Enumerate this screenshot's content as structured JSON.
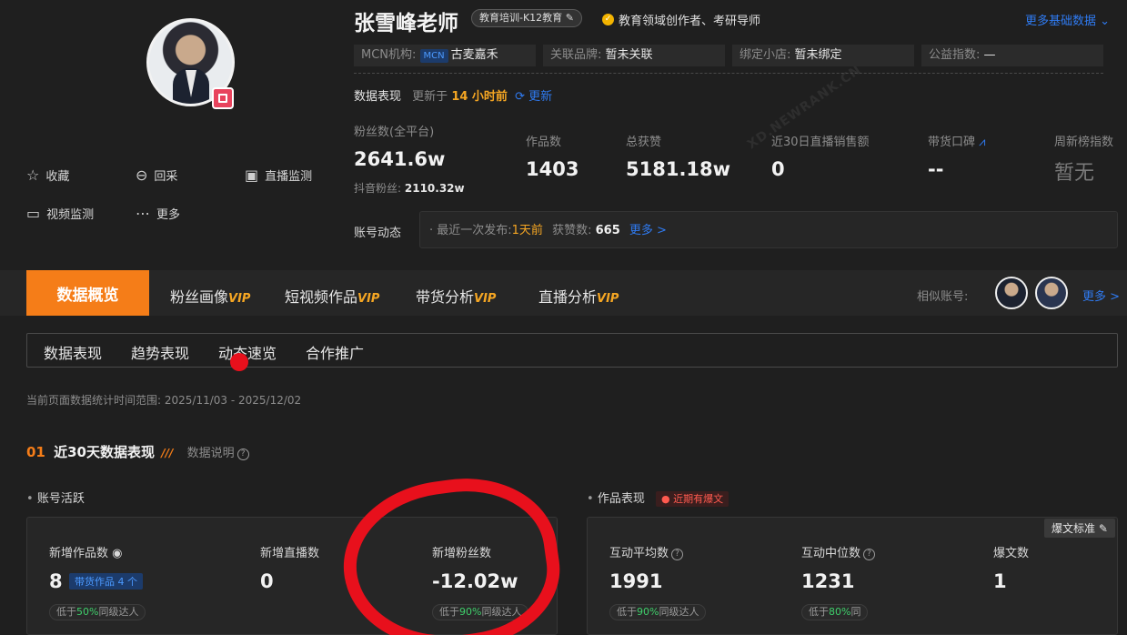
{
  "profile": {
    "name": "张雪峰老师",
    "tag": "教育培训-K12教育",
    "verify_text": "教育领域创作者、考研导师",
    "more_base": "更多基础数据",
    "mcn_label": "MCN机构:",
    "mcn_badge": "MCN",
    "mcn_value": "古麦嘉禾",
    "brand_label": "关联品牌:",
    "brand_value": "暂未关联",
    "shop_label": "绑定小店:",
    "shop_value": "暂未绑定",
    "charity_label": "公益指数:",
    "charity_value": "—"
  },
  "actions": {
    "collect": "收藏",
    "backtrack": "回采",
    "live_monitor": "直播监测",
    "video_monitor": "视频监测",
    "more": "更多"
  },
  "perf": {
    "title": "数据表现",
    "updated_prefix": "更新于",
    "updated_value": "14 小时前",
    "refresh": "更新",
    "fans_label": "粉丝数(全平台)",
    "fans_value": "2641.6w",
    "douyin_label": "抖音粉丝:",
    "douyin_value": "2110.32w",
    "works_label": "作品数",
    "works_value": "1403",
    "likes_label": "总获赞",
    "likes_value": "5181.18w",
    "live_label": "近30日直播销售额",
    "live_value": "0",
    "goods_label": "带货口碑",
    "goods_value": "--",
    "weekly_label": "周新榜指数",
    "weekly_value": "暂无"
  },
  "dynamic": {
    "label": "账号动态",
    "recent_label": "· 最近一次发布:",
    "recent_value": "1天前",
    "likes_label": "获赞数:",
    "likes_value": "665",
    "more": "更多 >"
  },
  "tabs": {
    "active": "数据概览",
    "fans": "粉丝画像",
    "short_video": "短视频作品",
    "goods": "带货分析",
    "live": "直播分析",
    "vip": "VIP",
    "similar_label": "相似账号:",
    "similar_more": "更多 >"
  },
  "subtabs": [
    "数据表现",
    "趋势表现",
    "动态速览",
    "合作推广"
  ],
  "period": "当前页面数据统计时间范围: 2025/11/03 - 2025/12/02",
  "section": {
    "num": "01",
    "title": "近30天数据表现",
    "explain": "数据说明"
  },
  "activity": {
    "title": "账号活跃",
    "new_works_label": "新增作品数",
    "new_works_value": "8",
    "new_works_badge": "带货作品 4 个",
    "new_works_pill_prefix": "低于",
    "new_works_pill_pct": "50%",
    "new_works_pill_suffix": "同级达人",
    "new_live_label": "新增直播数",
    "new_live_value": "0",
    "new_fans_label": "新增粉丝数",
    "new_fans_value": "-12.02w",
    "new_fans_pill_prefix": "低于",
    "new_fans_pill_pct": "90%",
    "new_fans_pill_suffix": "同级达人"
  },
  "works": {
    "title": "作品表现",
    "hot_tag": "近期有爆文",
    "standard": "爆文标准",
    "avg_label": "互动平均数",
    "avg_value": "1991",
    "avg_pill_prefix": "低于",
    "avg_pill_pct": "90%",
    "avg_pill_suffix": "同级达人",
    "median_label": "互动中位数",
    "median_value": "1231",
    "median_pill_prefix": "低于",
    "median_pill_pct": "80%",
    "median_pill_suffix": "同",
    "hot_count_label": "爆文数",
    "hot_count_value": "1"
  },
  "watermark": "XD.NEWRANK.CN",
  "colors": {
    "accent": "#f57d18",
    "link": "#2f7bf2",
    "good": "#3fcf6b",
    "annotation": "#e8101c"
  }
}
